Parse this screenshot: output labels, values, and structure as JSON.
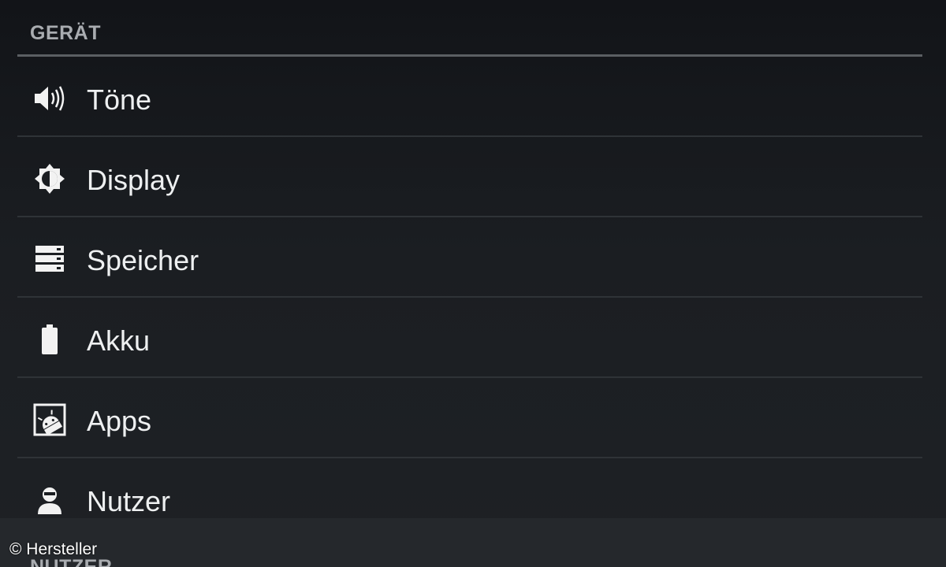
{
  "section": {
    "title": "GERÄT"
  },
  "items": [
    {
      "label": "Töne",
      "icon": "volume-icon"
    },
    {
      "label": "Display",
      "icon": "brightness-icon"
    },
    {
      "label": "Speicher",
      "icon": "storage-icon"
    },
    {
      "label": "Akku",
      "icon": "battery-icon"
    },
    {
      "label": "Apps",
      "icon": "apps-icon"
    },
    {
      "label": "Nutzer",
      "icon": "user-icon"
    }
  ],
  "next_section": {
    "title": "NUTZER"
  },
  "credit": "© Hersteller",
  "colors": {
    "background": "#1b1e22",
    "header_text": "#a9acb0",
    "item_text": "#eef0f1",
    "divider": "#2f3337"
  }
}
